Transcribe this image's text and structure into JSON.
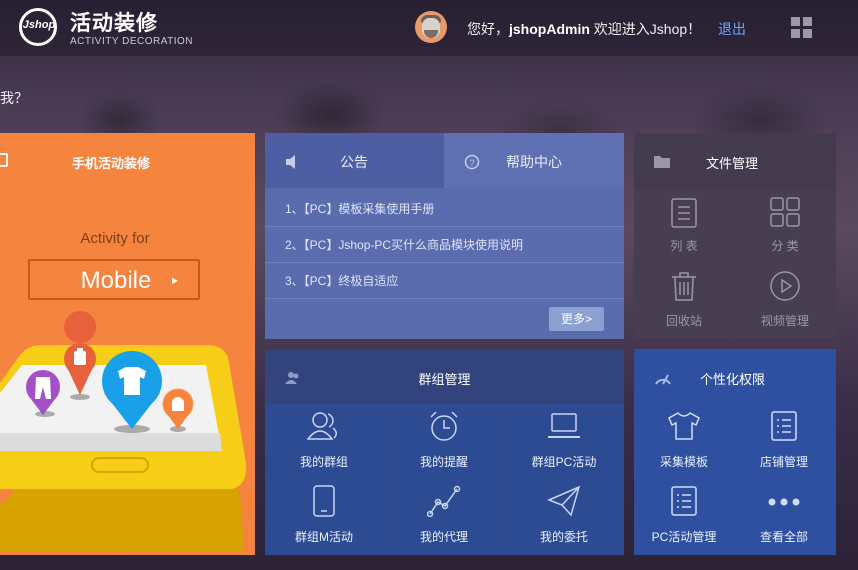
{
  "header": {
    "logo_text": "Jshop",
    "title": "活动装修",
    "subtitle": "ACTIVITY DECORATION",
    "greeting_prefix": "您好，",
    "username": "jshopAdmin",
    "greeting_suffix": " 欢迎进入Jshop！",
    "logout": "退出"
  },
  "question_text": "我？",
  "mobile_panel": {
    "title": "手机活动装修",
    "activity_for": "Activity for",
    "button_label": "Mobile",
    "arrow": "▸"
  },
  "notice_panel": {
    "tabs": [
      {
        "label": "公告",
        "icon": "speaker-icon"
      },
      {
        "label": "帮助中心",
        "icon": "question-circle-icon"
      }
    ],
    "items": [
      "1、【PC】模板采集使用手册",
      "2、【PC】Jshop-PC买什么商品模块使用说明",
      "3、【PC】终极自适应"
    ],
    "more": "更多>"
  },
  "files_panel": {
    "title": "文件管理",
    "items": [
      {
        "label": "列 表",
        "icon": "list-icon"
      },
      {
        "label": "分 类",
        "icon": "category-grid-icon"
      },
      {
        "label": "回收站",
        "icon": "trash-icon"
      },
      {
        "label": "视频管理",
        "icon": "play-icon"
      }
    ]
  },
  "group_panel": {
    "title": "群组管理",
    "items": [
      {
        "label": "我的群组",
        "icon": "users-icon"
      },
      {
        "label": "我的提醒",
        "icon": "alarm-clock-icon"
      },
      {
        "label": "群组PC活动",
        "icon": "laptop-icon"
      },
      {
        "label": "群组M活动",
        "icon": "phone-icon"
      },
      {
        "label": "我的代理",
        "icon": "line-chart-icon"
      },
      {
        "label": "我的委托",
        "icon": "paper-plane-icon"
      }
    ]
  },
  "perm_panel": {
    "title": "个性化权限",
    "items": [
      {
        "label": "采集模板",
        "icon": "tshirt-icon"
      },
      {
        "label": "店铺管理",
        "icon": "document-list-icon"
      },
      {
        "label": "PC活动管理",
        "icon": "document-list-icon"
      },
      {
        "label": "查看全部",
        "icon": "more-dots-icon"
      }
    ]
  },
  "colors": {
    "orange": "#f5843e",
    "notice_bg": "#5a6cae",
    "group_bg": "#2f4c93",
    "perm_bg": "#2f50a0",
    "link": "#6fa3ff"
  }
}
